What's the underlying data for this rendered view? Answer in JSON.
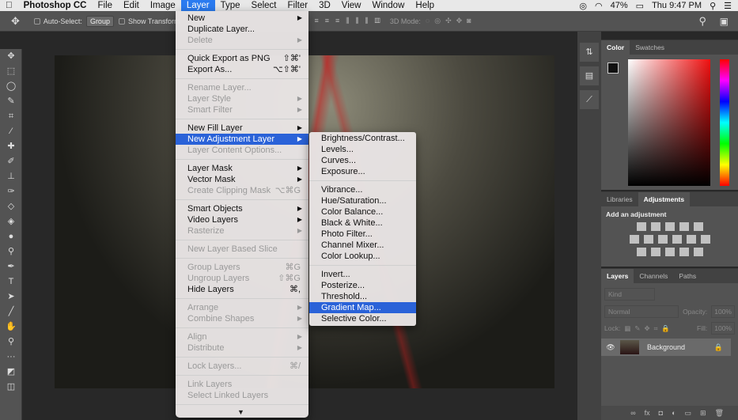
{
  "menubar": {
    "apple": "",
    "app": "Photoshop CC",
    "items": [
      "File",
      "Edit",
      "Image",
      "Layer",
      "Type",
      "Select",
      "Filter",
      "3D",
      "View",
      "Window",
      "Help"
    ],
    "battery": "47%",
    "clock": "Thu 9:47 PM"
  },
  "options": {
    "auto_select": "Auto-Select:",
    "group": "Group",
    "show_transform": "Show Transform",
    "mode_3d": "3D Mode:"
  },
  "layer_menu": [
    {
      "label": "New",
      "arrow": true
    },
    {
      "label": "Duplicate Layer..."
    },
    {
      "label": "Delete",
      "arrow": true,
      "disabled": true
    },
    {
      "sep": true
    },
    {
      "label": "Quick Export as PNG",
      "shortcut": "⇧⌘'"
    },
    {
      "label": "Export As...",
      "shortcut": "⌥⇧⌘'"
    },
    {
      "sep": true
    },
    {
      "label": "Rename Layer...",
      "disabled": true
    },
    {
      "label": "Layer Style",
      "arrow": true,
      "disabled": true
    },
    {
      "label": "Smart Filter",
      "arrow": true,
      "disabled": true
    },
    {
      "sep": true
    },
    {
      "label": "New Fill Layer",
      "arrow": true
    },
    {
      "label": "New Adjustment Layer",
      "arrow": true,
      "highlighted": true
    },
    {
      "label": "Layer Content Options...",
      "disabled": true
    },
    {
      "sep": true
    },
    {
      "label": "Layer Mask",
      "arrow": true
    },
    {
      "label": "Vector Mask",
      "arrow": true
    },
    {
      "label": "Create Clipping Mask",
      "shortcut": "⌥⌘G",
      "disabled": true
    },
    {
      "sep": true
    },
    {
      "label": "Smart Objects",
      "arrow": true
    },
    {
      "label": "Video Layers",
      "arrow": true
    },
    {
      "label": "Rasterize",
      "arrow": true,
      "disabled": true
    },
    {
      "sep": true
    },
    {
      "label": "New Layer Based Slice",
      "disabled": true
    },
    {
      "sep": true
    },
    {
      "label": "Group Layers",
      "shortcut": "⌘G",
      "disabled": true
    },
    {
      "label": "Ungroup Layers",
      "shortcut": "⇧⌘G",
      "disabled": true
    },
    {
      "label": "Hide Layers",
      "shortcut": "⌘,"
    },
    {
      "sep": true
    },
    {
      "label": "Arrange",
      "arrow": true,
      "disabled": true
    },
    {
      "label": "Combine Shapes",
      "arrow": true,
      "disabled": true
    },
    {
      "sep": true
    },
    {
      "label": "Align",
      "arrow": true,
      "disabled": true
    },
    {
      "label": "Distribute",
      "arrow": true,
      "disabled": true
    },
    {
      "sep": true
    },
    {
      "label": "Lock Layers...",
      "shortcut": "⌘/",
      "disabled": true
    },
    {
      "sep": true
    },
    {
      "label": "Link Layers",
      "disabled": true
    },
    {
      "label": "Select Linked Layers",
      "disabled": true
    },
    {
      "sep": true
    }
  ],
  "adjustment_submenu": [
    {
      "label": "Brightness/Contrast..."
    },
    {
      "label": "Levels..."
    },
    {
      "label": "Curves..."
    },
    {
      "label": "Exposure..."
    },
    {
      "sep": true
    },
    {
      "label": "Vibrance..."
    },
    {
      "label": "Hue/Saturation..."
    },
    {
      "label": "Color Balance..."
    },
    {
      "label": "Black & White..."
    },
    {
      "label": "Photo Filter..."
    },
    {
      "label": "Channel Mixer..."
    },
    {
      "label": "Color Lookup..."
    },
    {
      "sep": true
    },
    {
      "label": "Invert..."
    },
    {
      "label": "Posterize..."
    },
    {
      "label": "Threshold..."
    },
    {
      "label": "Gradient Map...",
      "highlighted": true
    },
    {
      "label": "Selective Color..."
    }
  ],
  "color_panel": {
    "tabs": [
      "Color",
      "Swatches"
    ]
  },
  "adjust_panel": {
    "tabs": [
      "Libraries",
      "Adjustments"
    ],
    "heading": "Add an adjustment"
  },
  "layers_panel": {
    "tabs": [
      "Layers",
      "Channels",
      "Paths"
    ],
    "kind": "Kind",
    "blend": "Normal",
    "opacity_label": "Opacity:",
    "opacity": "100%",
    "lock_label": "Lock:",
    "fill_label": "Fill:",
    "fill": "100%",
    "layer_name": "Background"
  },
  "colors": {
    "accent": "#2a62d8",
    "menubar_active": "#2a7bf0"
  }
}
